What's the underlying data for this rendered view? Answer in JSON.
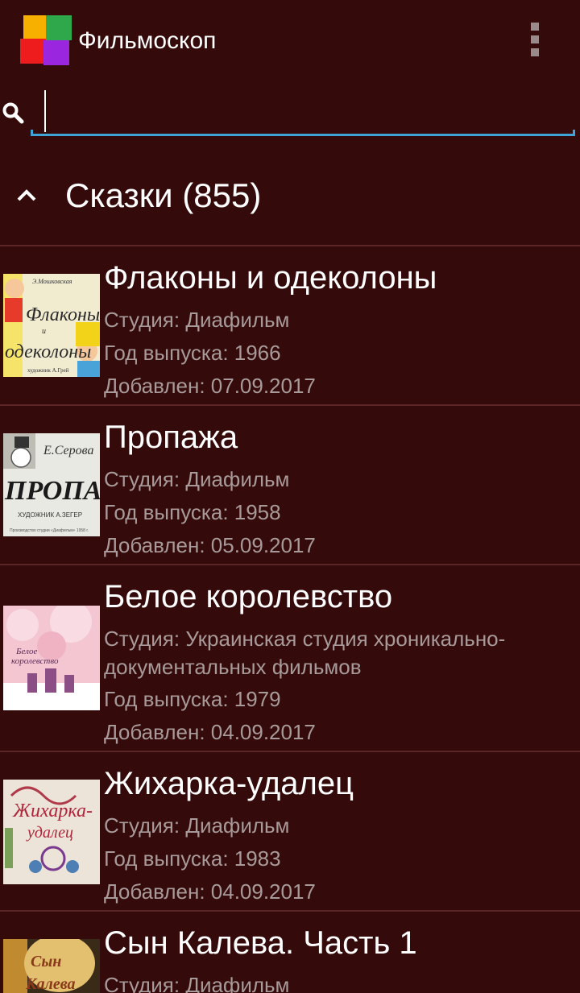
{
  "app": {
    "title": "Фильмоскоп",
    "logo_colors": [
      "#f8b000",
      "#2ea84a",
      "#ee1c1c",
      "#9a26e0"
    ],
    "icon_menu": "overflow-menu-icon"
  },
  "search": {
    "value": "",
    "placeholder": "",
    "icon": "search-icon",
    "accent": "#3ea5d6"
  },
  "group": {
    "title": "Сказки (855)",
    "icon": "chevron-up-icon"
  },
  "items": [
    {
      "title": "Флаконы и одеколоны",
      "studio": "Студия: Диафильм",
      "year": "Год выпуска: 1966",
      "added": "Добавлен: 07.09.2017"
    },
    {
      "title": "Пропажа",
      "studio": "Студия: Диафильм",
      "year": "Год выпуска: 1958",
      "added": "Добавлен: 05.09.2017"
    },
    {
      "title": "Белое королевство",
      "studio": "Студия: Украинская студия хроникально-",
      "studio_line2": "документальных фильмов",
      "year": "Год выпуска: 1979",
      "added": "Добавлен: 04.09.2017"
    },
    {
      "title": "Жихарка-удалец",
      "studio": "Студия: Диафильм",
      "year": "Год выпуска: 1983",
      "added": "Добавлен: 04.09.2017"
    },
    {
      "title": "Сын Калева. Часть 1",
      "studio": "Студия: Диафильм"
    }
  ],
  "colors": {
    "background": "#350a0a",
    "divider": "#5a2626",
    "secondary_text": "#a89a9a"
  }
}
